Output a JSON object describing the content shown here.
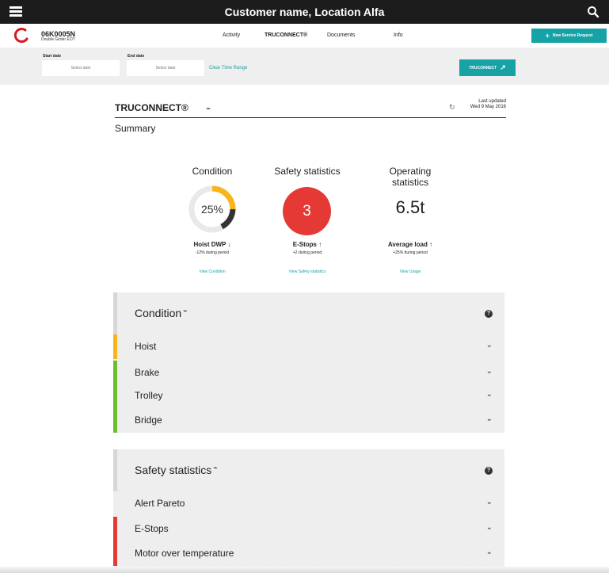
{
  "topbar": {
    "title": "Customer name, Location Alfa",
    "menu_icon": "hamburger-menu-icon",
    "search_icon": "search-icon"
  },
  "asset": {
    "id": "06K0005N",
    "type": "Double Girder EOT"
  },
  "nav": {
    "items": [
      "Activity",
      "TRUCONNECT®",
      "Documents",
      "Info"
    ],
    "active": "TRUCONNECT®",
    "service_button": "New Service Request"
  },
  "filters": {
    "start_label": "Start date",
    "end_label": "End date",
    "start_placeholder": "Select date",
    "end_placeholder": "Select date",
    "clear": "Clear Time Range",
    "truconnect_button": "TRUCONNECT"
  },
  "section": {
    "brand": "TRUCONNECT®",
    "last_updated_label": "Last updated",
    "last_updated_value": "Wed 9 May 2016",
    "summary_title": "Summary"
  },
  "summary": {
    "condition": {
      "title": "Condition",
      "value_text": "25%",
      "value_fraction": 0.25,
      "metric": "Hoist DWP",
      "trend": "down",
      "note": "-12% during period",
      "link": "View Condition"
    },
    "safety": {
      "title": "Safety statistics",
      "value": "3",
      "metric": "E-Stops",
      "trend": "up",
      "note": "+2 during period",
      "link": "View Safety statistics"
    },
    "operating": {
      "title_line1": "Operating",
      "title_line2": "statistics",
      "value": "6.5t",
      "metric": "Average load",
      "trend": "up",
      "note": "+25% during period",
      "link": "View Usage"
    }
  },
  "condition_panel": {
    "title": "Condition",
    "items": [
      {
        "label": "Hoist",
        "color": "#f7b51a"
      },
      {
        "label": "Brake",
        "color": "#6fbe2c"
      },
      {
        "label": "Trolley",
        "color": "#6fbe2c"
      },
      {
        "label": "Bridge",
        "color": "#6fbe2c"
      }
    ]
  },
  "safety_panel": {
    "title": "Safety statistics",
    "items": [
      {
        "label": "Alert Pareto",
        "color": "#eeeeee"
      },
      {
        "label": "E-Stops",
        "color": "#e53935"
      },
      {
        "label": "Motor over temperature",
        "color": "#e53935"
      }
    ]
  },
  "colors": {
    "teal": "#17a2a6",
    "red": "#e53935",
    "yellow": "#f7b51a",
    "green": "#6fbe2c"
  }
}
